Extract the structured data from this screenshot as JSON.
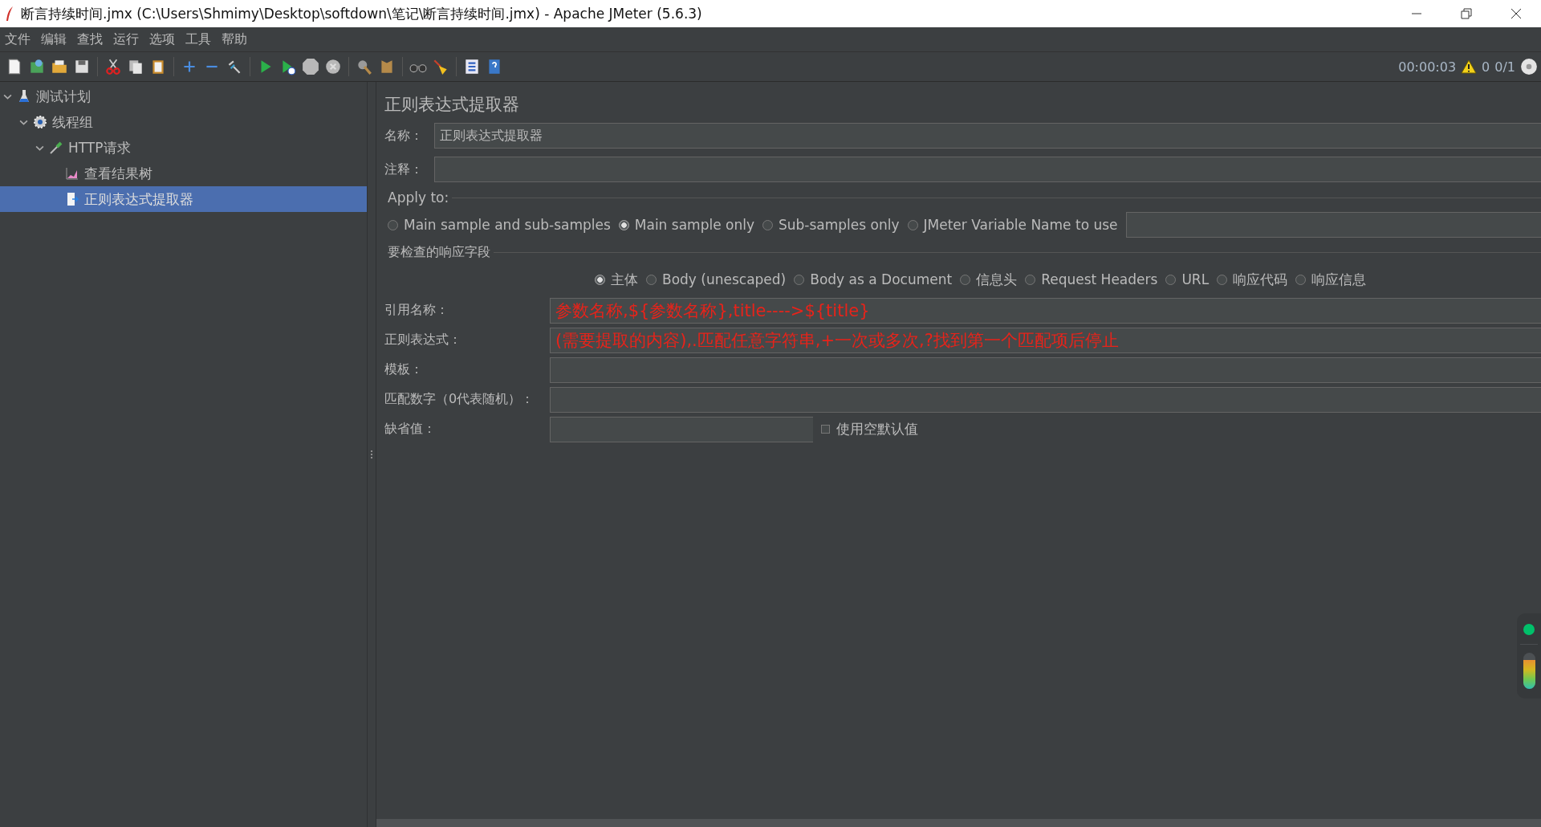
{
  "window": {
    "title": "断言持续时间.jmx (C:\\Users\\Shmimy\\Desktop\\softdown\\笔记\\断言持续时间.jmx) - Apache JMeter (5.6.3)"
  },
  "menu": [
    "文件",
    "编辑",
    "查找",
    "运行",
    "选项",
    "工具",
    "帮助"
  ],
  "status": {
    "elapsed": "00:00:03",
    "warnings": "0",
    "threads": "0/1"
  },
  "tree": [
    {
      "label": "测试计划",
      "kind": "plan",
      "expanded": true,
      "selected": false,
      "children": [
        {
          "label": "线程组",
          "kind": "threads",
          "expanded": true,
          "selected": false,
          "children": [
            {
              "label": "HTTP请求",
              "kind": "sampler",
              "expanded": true,
              "selected": false,
              "children": [
                {
                  "label": "查看结果树",
                  "kind": "listener",
                  "selected": false
                },
                {
                  "label": "正则表达式提取器",
                  "kind": "extractor",
                  "selected": true
                }
              ]
            }
          ]
        }
      ]
    }
  ],
  "panel": {
    "title": "正则表达式提取器",
    "name_label": "名称：",
    "name_value": "正则表达式提取器",
    "comment_label": "注释：",
    "apply_to": {
      "legend": "Apply to:",
      "options": [
        {
          "label": "Main sample and sub-samples",
          "selected": false
        },
        {
          "label": "Main sample only",
          "selected": true
        },
        {
          "label": "Sub-samples only",
          "selected": false
        },
        {
          "label": "JMeter Variable Name to use",
          "selected": false
        }
      ]
    },
    "field_check": {
      "legend": "要检查的响应字段",
      "options": [
        {
          "label": "主体",
          "selected": true
        },
        {
          "label": "Body (unescaped)",
          "selected": false
        },
        {
          "label": "Body as a Document",
          "selected": false
        },
        {
          "label": "信息头",
          "selected": false
        },
        {
          "label": "Request Headers",
          "selected": false
        },
        {
          "label": "URL",
          "selected": false
        },
        {
          "label": "响应代码",
          "selected": false
        },
        {
          "label": "响应信息",
          "selected": false
        }
      ]
    },
    "fields": [
      {
        "label": "引用名称：",
        "value": "参数名称,${参数名称},title---->${title}"
      },
      {
        "label": "正则表达式：",
        "value": "(需要提取的内容),.匹配任意字符串,+一次或多次,?找到第一个匹配项后停止"
      },
      {
        "label": "模板："
      },
      {
        "label": "匹配数字（0代表随机）："
      }
    ],
    "default": {
      "label": "缺省值：",
      "checkbox": {
        "label": "使用空默认值",
        "checked": false
      }
    }
  },
  "side_widget": {
    "level": 0.8
  }
}
